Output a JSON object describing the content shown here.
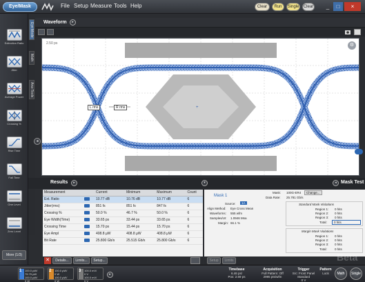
{
  "app": {
    "brand_label": "Eye/Mask",
    "menu": [
      "File",
      "Setup",
      "Measure",
      "Tools",
      "Help"
    ],
    "pills": [
      {
        "label": "Clear",
        "color": "#e8e0c8"
      },
      {
        "label": "Run",
        "color": "#f2e38a"
      },
      {
        "label": "Single",
        "color": "#f2e38a"
      },
      {
        "label": "Clear",
        "color": "#d9d9d9"
      }
    ],
    "window_buttons": [
      "_",
      "□",
      "×"
    ]
  },
  "palette": {
    "items": [
      {
        "label": "Extinction Ratio",
        "icon": "extinction-ratio-icon"
      },
      {
        "label": "Jitter",
        "icon": "jitter-icon"
      },
      {
        "label": "Average Power",
        "icon": "average-power-icon"
      },
      {
        "label": "Crossing %",
        "icon": "crossing-percent-icon"
      },
      {
        "label": "Rise Time",
        "icon": "rise-time-icon"
      },
      {
        "label": "Fall Time",
        "icon": "fall-time-icon"
      },
      {
        "label": "One Level",
        "icon": "one-level-icon"
      },
      {
        "label": "Zero Level",
        "icon": "zero-level-icon"
      }
    ],
    "more_label": "More (1/3)",
    "side_tabs": [
      "Eye Mode",
      "Math",
      "Ana-Tools"
    ]
  },
  "waveform": {
    "title": "Waveform",
    "marker_left": "L rms",
    "marker_right": "R rms",
    "scale_label": "2.50 ps"
  },
  "results": {
    "title": "Results",
    "columns": [
      "Measurement",
      "",
      "Current",
      "Minimum",
      "Maximum",
      "Count"
    ],
    "rows": [
      {
        "name": "Ext. Ratio",
        "current": "10.77 dB",
        "min": "10.76 dB",
        "max": "10.77 dB",
        "count": "6",
        "selected": true
      },
      {
        "name": "Jitter(rms)",
        "current": "851 fs",
        "min": "851 fs",
        "max": "847 fs",
        "count": "6",
        "selected": false
      },
      {
        "name": "Crossing %",
        "current": "50.0 %",
        "min": "46.7 %",
        "max": "50.0 %",
        "count": "6",
        "selected": false
      },
      {
        "name": "Eye Width(Time)",
        "current": "33.65 ps",
        "min": "33.44 ps",
        "max": "33.65 ps",
        "count": "6",
        "selected": false
      },
      {
        "name": "Crossing Time",
        "current": "15.70 ps",
        "min": "15.44 ps",
        "max": "15.70 ps",
        "count": "6",
        "selected": false
      },
      {
        "name": "Eye Ampl",
        "current": "408.8 µW",
        "min": "408.8 µW",
        "max": "408.8 µW",
        "count": "6",
        "selected": false
      },
      {
        "name": "Bit Rate",
        "current": "25.800 Gb/s",
        "min": "25.515 Gb/s",
        "max": "25.800 Gb/s",
        "count": "6",
        "selected": false
      }
    ],
    "actions": [
      "Details...",
      "Limits...",
      "Setup..."
    ]
  },
  "mask_test": {
    "title": "Mask Test",
    "tab": "Mask 1",
    "mask_label": "Mask:",
    "mask_value": "100G-ER4",
    "change_label": "Change...",
    "data_rate_label": "Data Rate:",
    "data_rate_value": "25.781 Gb/s",
    "source_label": "Source:",
    "source_value": "1A",
    "align_label": "Align Method:",
    "align_value": "Eye Cross Mean",
    "waveforms_label": "Waveforms:",
    "waveforms_value": "555 wfm",
    "samples_label": "Samples/UI:",
    "samples_value": "1.0946 Msa",
    "margin_label": "Margin:",
    "margin_value": "66.1 %",
    "standard_title": "Standard Mask Violations",
    "standard_rows": [
      {
        "label": "Region 1:",
        "value": "0 hits"
      },
      {
        "label": "Region 2:",
        "value": "0 hits"
      },
      {
        "label": "Region 3:",
        "value": "0 hits"
      },
      {
        "label": "Total:",
        "value": "0 hits"
      }
    ],
    "margin_title": "Margin Mask Violations",
    "margin_rows": [
      {
        "label": "Region 1:",
        "value": "0 hits"
      },
      {
        "label": "Region 2:",
        "value": "0 hits"
      },
      {
        "label": "Region 3:",
        "value": "0 hits"
      },
      {
        "label": "Total:",
        "value": "0 hits"
      }
    ],
    "toolbar": [
      "Setup",
      "Limits"
    ],
    "watermark": "Beta"
  },
  "status": {
    "channels": [
      {
        "num": "1",
        "l1": "100.0 µW/",
        "l2": "75.75 µW",
        "l3": "100.0 µW/",
        "l4": "0 W",
        "color": "#3a7bd5"
      },
      {
        "num": "2",
        "l1": "100.0 µW/",
        "l2": "0 W",
        "l3": "100.0 µW/",
        "l4": "0 W",
        "color": "#d98a2b"
      },
      {
        "num": "3",
        "l1": "100.0 mV/",
        "l2": "0 V",
        "l3": "100.0 mV/",
        "l4": "0 V",
        "color": "#7a7a7a"
      }
    ],
    "timebase": {
      "title": "Timebase",
      "l1": "6.46 ps/",
      "l2": "Pos: 2.69 ps"
    },
    "acquisition": {
      "title": "Acquisition",
      "l1": "Full Pattern: Off",
      "l2": "2995 pts/wfm"
    },
    "trigger": {
      "title": "Trigger",
      "l1": "Src: Front Panel",
      "l2": "Standard",
      "l3": "0 V"
    },
    "pattern": {
      "title": "Pattern",
      "l1": "Lock"
    },
    "buttons": [
      "Math",
      "Single"
    ]
  },
  "colors": {
    "accent": "#2c67b2",
    "eye_blue": "#2f5fb0",
    "mask_gray": "#a9a9a9",
    "selected_row": "#c9ddf2"
  }
}
